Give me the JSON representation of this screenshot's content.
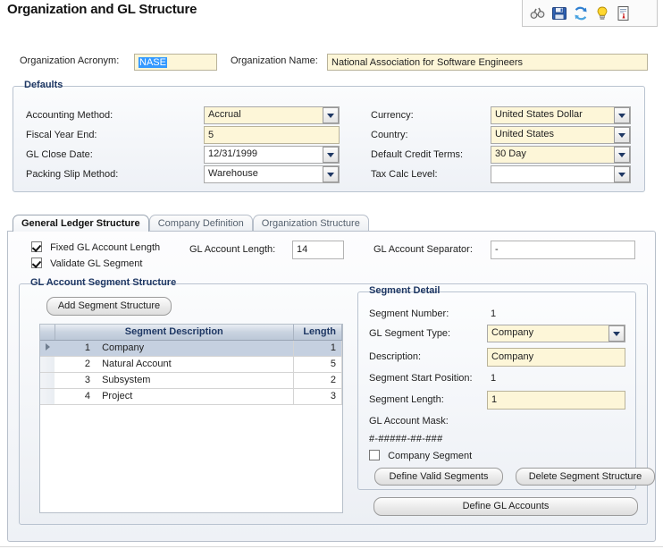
{
  "window": {
    "title": "Organization and GL Structure"
  },
  "toolbar": {
    "icons": [
      {
        "name": "binoculars-icon",
        "label": "Find"
      },
      {
        "name": "save-icon",
        "label": "Save"
      },
      {
        "name": "refresh-icon",
        "label": "Refresh"
      },
      {
        "name": "lightbulb-icon",
        "label": "Hint"
      },
      {
        "name": "report-icon",
        "label": "Report"
      }
    ]
  },
  "top_form": {
    "acronym_label": "Organization Acronym:",
    "acronym_value": "NASE",
    "name_label": "Organization Name:",
    "name_value": "National Association for Software Engineers"
  },
  "defaults": {
    "title": "Defaults",
    "left": [
      {
        "label": "Accounting Method:",
        "value": "Accrual",
        "type": "dropdown",
        "highlight": true
      },
      {
        "label": "Fiscal Year End:",
        "value": "5",
        "type": "text",
        "highlight": true
      },
      {
        "label": "GL Close Date:",
        "value": "12/31/1999",
        "type": "dropdown",
        "highlight": false
      },
      {
        "label": "Packing Slip Method:",
        "value": "Warehouse",
        "type": "dropdown",
        "highlight": false
      }
    ],
    "right": [
      {
        "label": "Currency:",
        "value": "United States Dollar",
        "type": "dropdown",
        "highlight": true
      },
      {
        "label": "Country:",
        "value": "United States",
        "type": "dropdown",
        "highlight": true
      },
      {
        "label": "Default Credit Terms:",
        "value": "30 Day",
        "type": "dropdown",
        "highlight": true
      },
      {
        "label": "Tax Calc Level:",
        "value": "",
        "type": "dropdown",
        "highlight": false
      }
    ]
  },
  "tabs": [
    {
      "label": "General Ledger Structure",
      "active": true
    },
    {
      "label": "Company Definition",
      "active": false
    },
    {
      "label": "Organization Structure",
      "active": false
    }
  ],
  "gl_options": {
    "fixed_length_label": "Fixed GL Account Length",
    "fixed_length_checked": true,
    "validate_segment_label": "Validate GL Segment",
    "validate_segment_checked": true,
    "account_length_label": "GL Account Length:",
    "account_length_value": "14",
    "separator_label": "GL Account Separator:",
    "separator_value": "-"
  },
  "segment_structure": {
    "title": "GL Account Segment Structure",
    "add_button": "Add Segment Structure",
    "columns": [
      "Segment Description",
      "Length"
    ],
    "rows": [
      {
        "num": "1",
        "description": "Company",
        "length": "1",
        "selected": true
      },
      {
        "num": "2",
        "description": "Natural Account",
        "length": "5",
        "selected": false
      },
      {
        "num": "3",
        "description": "Subsystem",
        "length": "2",
        "selected": false
      },
      {
        "num": "4",
        "description": "Project",
        "length": "3",
        "selected": false
      }
    ]
  },
  "segment_detail": {
    "title": "Segment Detail",
    "segment_number_label": "Segment Number:",
    "segment_number_value": "1",
    "segment_type_label": "GL Segment Type:",
    "segment_type_value": "Company",
    "description_label": "Description:",
    "description_value": "Company",
    "start_position_label": "Segment Start Position:",
    "start_position_value": "1",
    "segment_length_label": "Segment Length:",
    "segment_length_value": "1",
    "mask_label": "GL Account Mask:",
    "mask_value": "#-#####-##-###",
    "company_segment_label": "Company Segment",
    "company_segment_checked": false,
    "define_valid_segments_button": "Define Valid Segments",
    "delete_segment_structure_button": "Delete Segment Structure"
  },
  "footer": {
    "define_gl_accounts_button": "Define GL Accounts"
  },
  "colors": {
    "field_yellow": "#fdf6d8",
    "group_title": "#1f3864",
    "selection_blue": "#3399ff",
    "row_selected": "#c5d0e0"
  }
}
